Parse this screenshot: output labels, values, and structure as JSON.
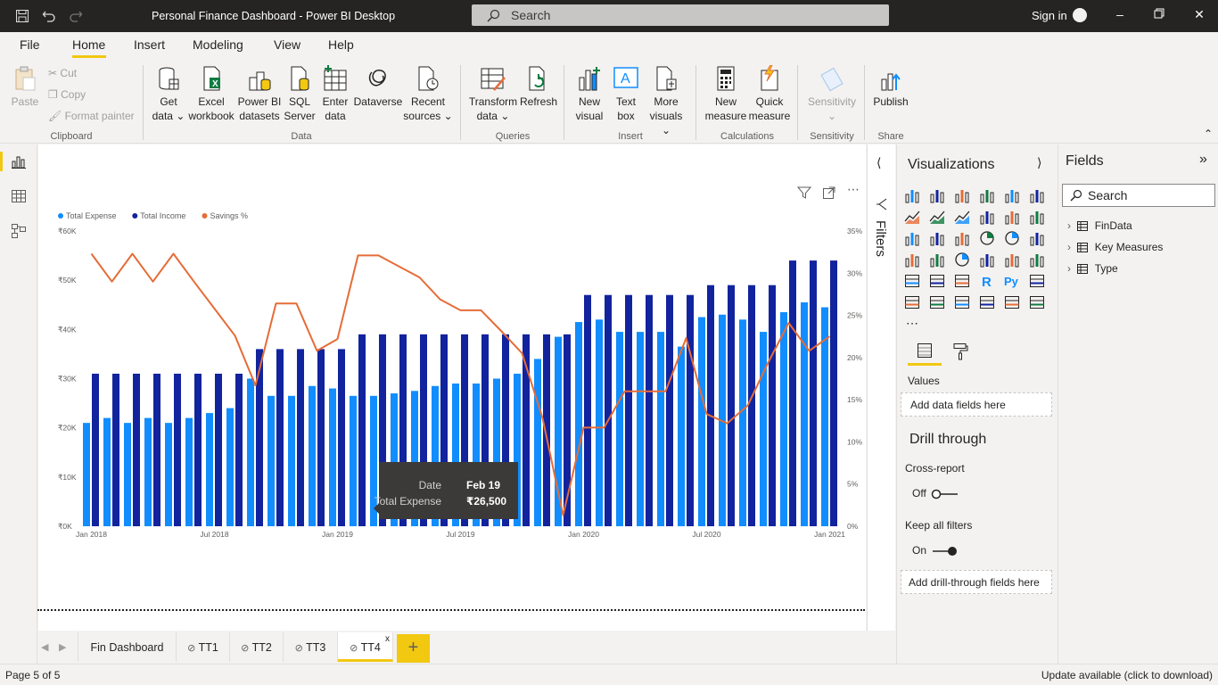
{
  "window": {
    "title": "Personal Finance Dashboard - Power BI Desktop",
    "search_placeholder": "Search",
    "sign_in": "Sign in"
  },
  "menu": [
    "File",
    "Home",
    "Insert",
    "Modeling",
    "View",
    "Help"
  ],
  "ribbon": {
    "clipboard": {
      "paste": "Paste",
      "cut": "Cut",
      "copy": "Copy",
      "format_painter": "Format painter",
      "group": "Clipboard"
    },
    "data": {
      "get_data": [
        "Get",
        "data"
      ],
      "excel": [
        "Excel",
        "workbook"
      ],
      "pbi_datasets": [
        "Power BI",
        "datasets"
      ],
      "sql": [
        "SQL",
        "Server"
      ],
      "enter_data": [
        "Enter",
        "data"
      ],
      "dataverse": [
        "Dataverse"
      ],
      "recent": [
        "Recent",
        "sources"
      ],
      "group": "Data"
    },
    "queries": {
      "transform": [
        "Transform",
        "data"
      ],
      "refresh": [
        "Refresh"
      ],
      "group": "Queries"
    },
    "insert": {
      "new_visual": [
        "New",
        "visual"
      ],
      "text_box": [
        "Text",
        "box"
      ],
      "more_visuals": [
        "More",
        "visuals"
      ],
      "group": "Insert"
    },
    "calculations": {
      "new_measure": [
        "New",
        "measure"
      ],
      "quick_measure": [
        "Quick",
        "measure"
      ],
      "group": "Calculations"
    },
    "sensitivity": {
      "label": [
        "Sensitivity"
      ],
      "group": "Sensitivity"
    },
    "share": {
      "publish": [
        "Publish"
      ],
      "group": "Share"
    }
  },
  "filters_label": "Filters",
  "visualizations": {
    "title": "Visualizations",
    "values_label": "Values",
    "values_well": "Add data fields here",
    "drill_through": "Drill through",
    "cross_report": "Cross-report",
    "cross_report_state": "Off",
    "keep_filters": "Keep all filters",
    "keep_filters_state": "On",
    "drill_well": "Add drill-through fields here"
  },
  "fields": {
    "title": "Fields",
    "search_placeholder": "Search",
    "tables": [
      "FinData",
      "Key Measures",
      "Type"
    ]
  },
  "tabs": [
    "Fin Dashboard",
    "TT1",
    "TT2",
    "TT3",
    "TT4"
  ],
  "active_tab": "TT4",
  "status": {
    "page": "Page 5 of 5",
    "update": "Update available (click to download)"
  },
  "tooltip": {
    "date_label": "Date",
    "date_value": "Feb 19",
    "expense_label": "Total Expense",
    "expense_value": "₹26,500"
  },
  "chart_data": {
    "type": "bar",
    "legend": [
      "Total Expense",
      "Total Income",
      "Savings %"
    ],
    "legend_position": "top-left",
    "colors": {
      "Total Expense": "#118dff",
      "Total Income": "#12239e",
      "Savings %": "#e66c37"
    },
    "categories": [
      "Jan 2018",
      "Feb 2018",
      "Mar 2018",
      "Apr 2018",
      "May 2018",
      "Jun 2018",
      "Jul 2018",
      "Aug 2018",
      "Sep 2018",
      "Oct 2018",
      "Nov 2018",
      "Dec 2018",
      "Jan 2019",
      "Feb 2019",
      "Mar 2019",
      "Apr 2019",
      "May 2019",
      "Jun 2019",
      "Jul 2019",
      "Aug 2019",
      "Sep 2019",
      "Oct 2019",
      "Nov 2019",
      "Dec 2019",
      "Jan 2020",
      "Feb 2020",
      "Mar 2020",
      "Apr 2020",
      "May 2020",
      "Jun 2020",
      "Jul 2020",
      "Aug 2020",
      "Sep 2020",
      "Oct 2020",
      "Nov 2020",
      "Dec 2020",
      "Jan 2021"
    ],
    "x_tick_labels": [
      "Jan 2018",
      "Jul 2018",
      "Jan 2019",
      "Jul 2019",
      "Jan 2020",
      "Jul 2020",
      "Jan 2021"
    ],
    "y_tick_labels": [
      "₹0K",
      "₹10K",
      "₹20K",
      "₹30K",
      "₹40K",
      "₹50K",
      "₹60K"
    ],
    "y2_tick_labels": [
      "0%",
      "5%",
      "10%",
      "15%",
      "20%",
      "25%",
      "30%",
      "35%"
    ],
    "ylim": [
      0,
      60000
    ],
    "y2lim": [
      0,
      35
    ],
    "series": [
      {
        "name": "Total Expense",
        "axis": "left",
        "values": [
          21000,
          22000,
          21000,
          22000,
          21000,
          22000,
          23000,
          24000,
          30000,
          26500,
          26500,
          28500,
          28000,
          26500,
          26500,
          27000,
          27500,
          28500,
          29000,
          29000,
          30000,
          31000,
          34000,
          38500,
          41500,
          42000,
          39500,
          39500,
          39500,
          36500,
          42500,
          43000,
          42000,
          39500,
          43500,
          45500,
          44500
        ]
      },
      {
        "name": "Total Income",
        "axis": "left",
        "values": [
          31000,
          31000,
          31000,
          31000,
          31000,
          31000,
          31000,
          31000,
          36000,
          36000,
          36000,
          36000,
          36000,
          39000,
          39000,
          39000,
          39000,
          39000,
          39000,
          39000,
          39000,
          39000,
          39000,
          39000,
          47000,
          47000,
          47000,
          47000,
          47000,
          47000,
          49000,
          49000,
          49000,
          49000,
          54000,
          54000,
          54000
        ]
      },
      {
        "name": "Savings %",
        "axis": "right",
        "values": [
          32.3,
          29.0,
          32.3,
          29.0,
          32.3,
          29.0,
          25.8,
          22.6,
          16.7,
          26.4,
          26.4,
          20.8,
          22.2,
          32.1,
          32.1,
          30.8,
          29.5,
          26.9,
          25.6,
          25.6,
          23.1,
          20.5,
          12.8,
          1.3,
          11.7,
          11.7,
          16.0,
          16.0,
          16.0,
          22.3,
          13.3,
          12.2,
          14.3,
          19.4,
          24.1,
          20.8,
          22.5
        ]
      }
    ]
  }
}
